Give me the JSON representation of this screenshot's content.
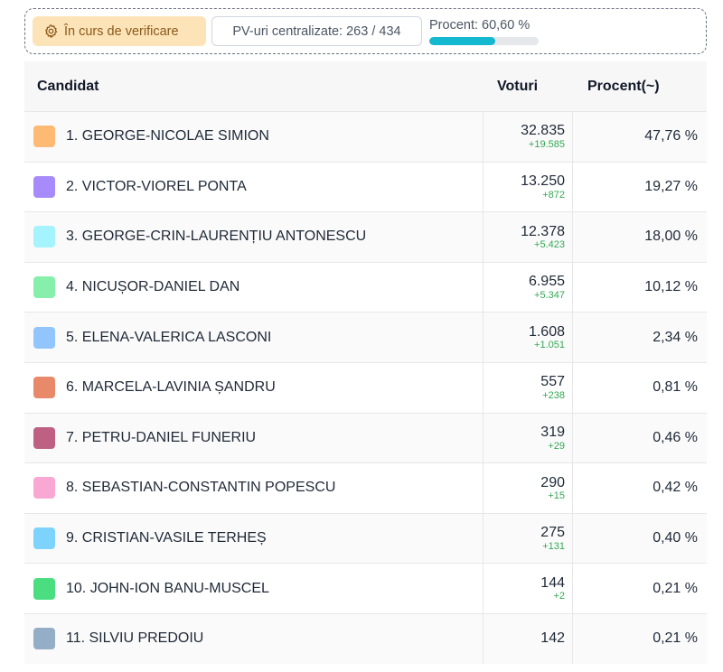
{
  "status": {
    "verification_label": "În curs de verificare",
    "pv_label": "PV-uri centralizate: 263 / 434",
    "percent_label": "Procent: 60,60 %",
    "percent_value": 60.6
  },
  "table": {
    "headers": {
      "candidate": "Candidat",
      "votes": "Voturi",
      "percent": "Procent(~)"
    },
    "rows": [
      {
        "name": "1. GEORGE-NICOLAE SIMION",
        "votes": "32.835",
        "delta": "+19.585",
        "percent": "47,76 %",
        "color": "#fdba74"
      },
      {
        "name": "2. VICTOR-VIOREL PONTA",
        "votes": "13.250",
        "delta": "+872",
        "percent": "19,27 %",
        "color": "#a78bfa"
      },
      {
        "name": "3. GEORGE-CRIN-LAURENȚIU ANTONESCU",
        "votes": "12.378",
        "delta": "+5.423",
        "percent": "18,00 %",
        "color": "#a5f3fc"
      },
      {
        "name": "4. NICUȘOR-DANIEL DAN",
        "votes": "6.955",
        "delta": "+5.347",
        "percent": "10,12 %",
        "color": "#86efac"
      },
      {
        "name": "5. ELENA-VALERICA LASCONI",
        "votes": "1.608",
        "delta": "+1.051",
        "percent": "2,34 %",
        "color": "#93c5fd"
      },
      {
        "name": "6. MARCELA-LAVINIA ȘANDRU",
        "votes": "557",
        "delta": "+238",
        "percent": "0,81 %",
        "color": "#e8896a"
      },
      {
        "name": "7. PETRU-DANIEL FUNERIU",
        "votes": "319",
        "delta": "+29",
        "percent": "0,46 %",
        "color": "#be6082"
      },
      {
        "name": "8. SEBASTIAN-CONSTANTIN POPESCU",
        "votes": "290",
        "delta": "+15",
        "percent": "0,42 %",
        "color": "#f9a8d4"
      },
      {
        "name": "9. CRISTIAN-VASILE TERHEȘ",
        "votes": "275",
        "delta": "+131",
        "percent": "0,40 %",
        "color": "#7dd3fc"
      },
      {
        "name": "10. JOHN-ION BANU-MUSCEL",
        "votes": "144",
        "delta": "+2",
        "percent": "0,21 %",
        "color": "#4ade80"
      },
      {
        "name": "11. SILVIU PREDOIU",
        "votes": "142",
        "delta": "",
        "percent": "0,21 %",
        "color": "#94aec8"
      }
    ]
  }
}
